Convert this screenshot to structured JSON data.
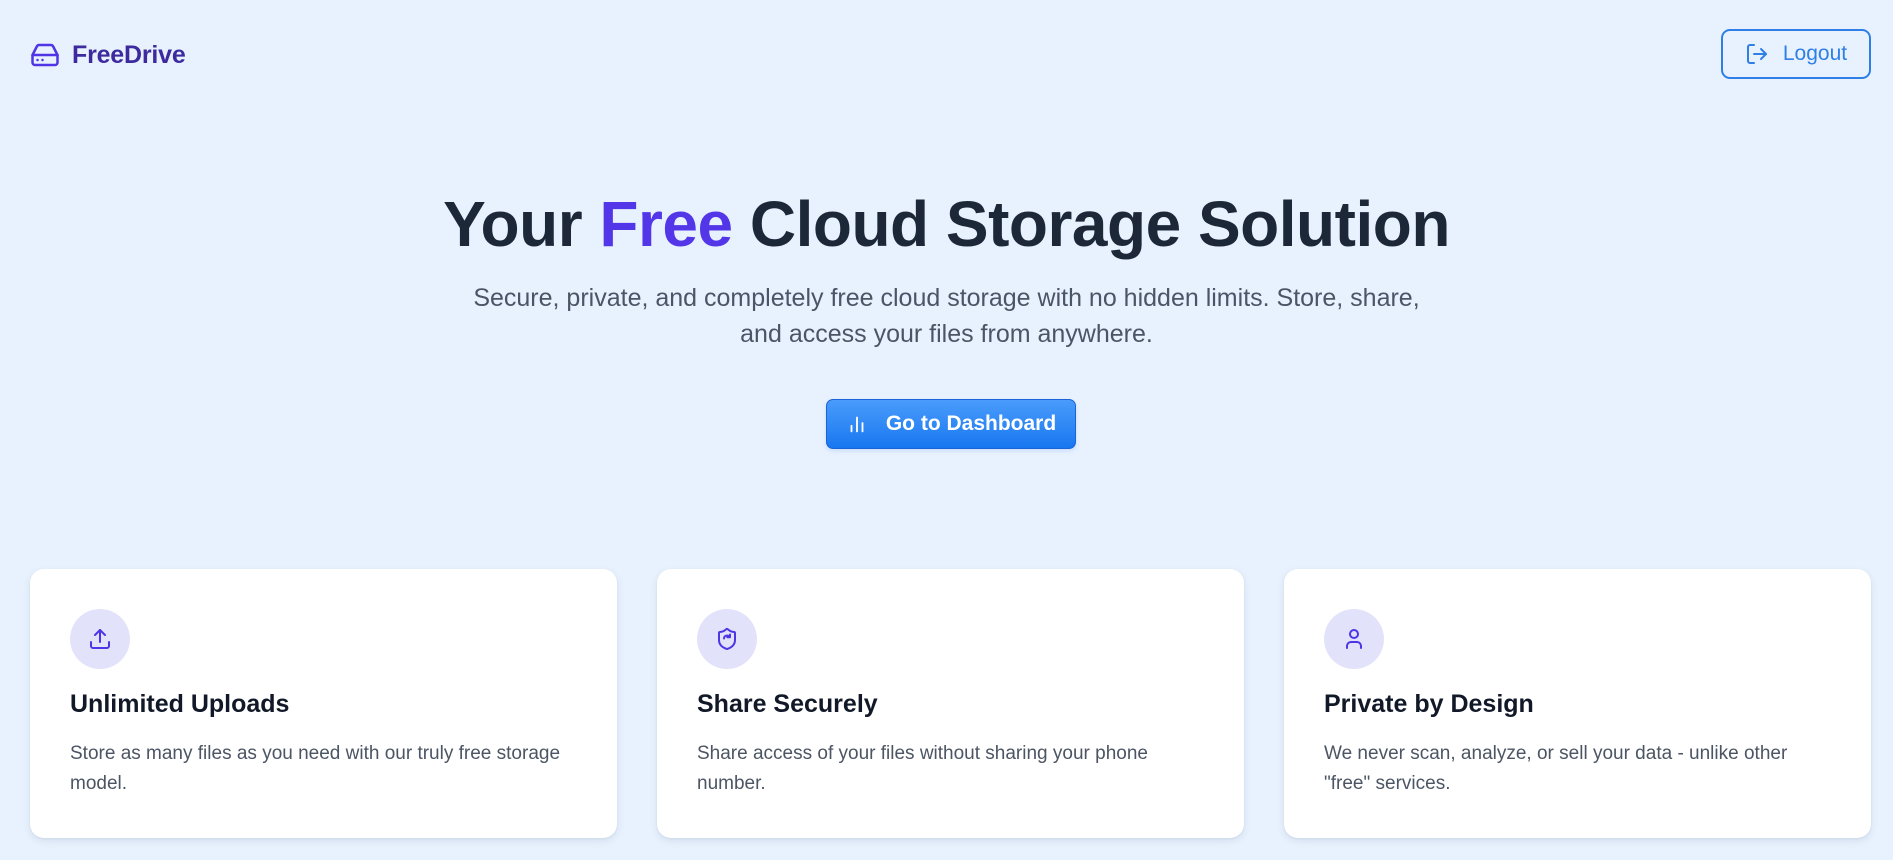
{
  "brand": {
    "name": "FreeDrive",
    "icon": "hard-drive-icon",
    "color": "#3c2a9e"
  },
  "header": {
    "logout_label": "Logout",
    "logout_icon": "logout-icon"
  },
  "hero": {
    "title_prefix": "Your ",
    "title_accent": "Free",
    "title_suffix": " Cloud Storage Solution",
    "subtitle": "Secure, private, and completely free cloud storage with no hidden limits. Store, share, and access your files from anywhere.",
    "cta_label": "Go to Dashboard",
    "cta_icon": "bar-chart-icon"
  },
  "features": [
    {
      "icon": "upload-icon",
      "title": "Unlimited Uploads",
      "description": "Store as many files as you need with our truly free storage model."
    },
    {
      "icon": "shield-share-icon",
      "title": "Share Securely",
      "description": "Share access of your files without sharing your phone number."
    },
    {
      "icon": "user-icon",
      "title": "Private by Design",
      "description": "We never scan, analyze, or sell your data - unlike other \"free\" services."
    }
  ],
  "colors": {
    "background": "#e8f2fe",
    "accent_purple": "#5236e8",
    "primary_blue": "#2f7fe6",
    "icon_circle": "#e2e3fb"
  }
}
